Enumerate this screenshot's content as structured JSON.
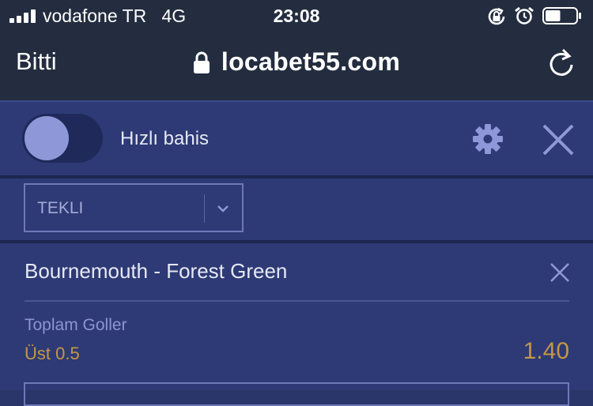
{
  "status_bar": {
    "carrier": "vodafone TR",
    "network": "4G",
    "time": "23:08",
    "battery_level": 0.5,
    "signal_bars": 4
  },
  "browser": {
    "done_label": "Bitti",
    "url": "locabet55.com",
    "icons": [
      "lock-icon",
      "reload-icon",
      "rotation-lock-icon",
      "alarm-icon",
      "battery-icon"
    ]
  },
  "betslip": {
    "quick_bet_label": "Hızlı bahis",
    "quick_bet_on": false,
    "bet_type": "TEKLI",
    "icons": [
      "gear-icon",
      "close-icon",
      "chevron-down-icon"
    ]
  },
  "bet": {
    "match": "Bournemouth - Forest Green",
    "market": "Toplam Goller",
    "selection": "Üst 0.5",
    "odds": "1.40"
  },
  "colors": {
    "top_bar": "#232d3f",
    "panel": "#2d3a75",
    "accent_gold": "#c79645",
    "toggle_knob": "#8e98d8",
    "icon_tint": "#8e98d8"
  }
}
